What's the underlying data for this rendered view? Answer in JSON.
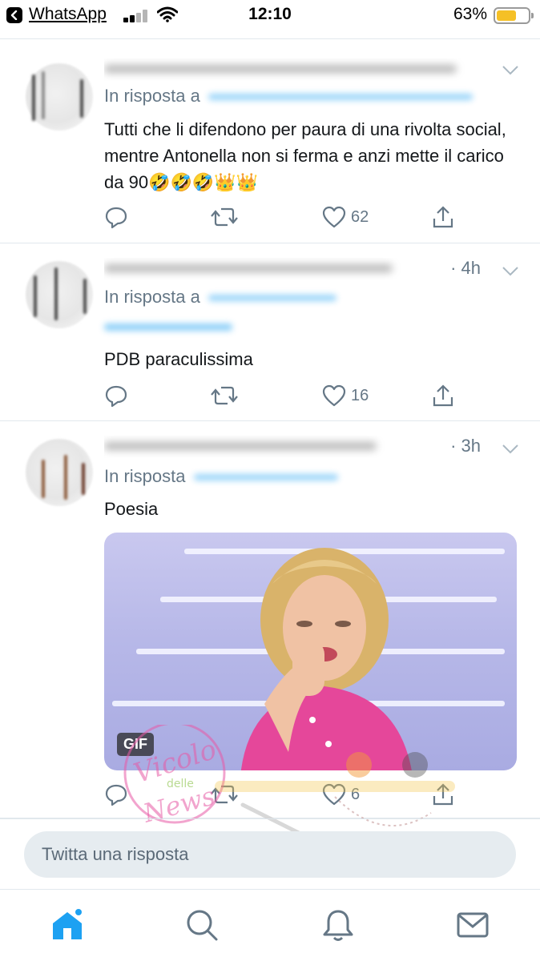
{
  "status_bar": {
    "back_app": "WhatsApp",
    "time": "12:10",
    "battery_percent": "63%",
    "battery_level": 0.63
  },
  "tweets": [
    {
      "meta": "",
      "reply_prefix": "In risposta a",
      "text": "Tutti che li difendono per paura di una rivolta social, mentre Antonella non si ferma e anzi mette il carico da 90🤣🤣🤣👑👑",
      "likes": "62"
    },
    {
      "meta": "· 4h",
      "reply_prefix": "In risposta a",
      "text": "PDB paraculissima",
      "likes": "16"
    },
    {
      "meta": "· 3h",
      "reply_prefix": "In risposta",
      "text": "Poesia",
      "likes": "6",
      "media_badge": "GIF"
    }
  ],
  "reply_box": {
    "placeholder": "Twitta una risposta"
  },
  "colors": {
    "accent": "#1da1f2",
    "muted": "#657786",
    "divider": "#e1e8ed",
    "battery": "#f5c026",
    "watermark": "#e75aa6"
  },
  "tab_bar": [
    "home-icon",
    "search-icon",
    "bell-icon",
    "mail-icon"
  ]
}
